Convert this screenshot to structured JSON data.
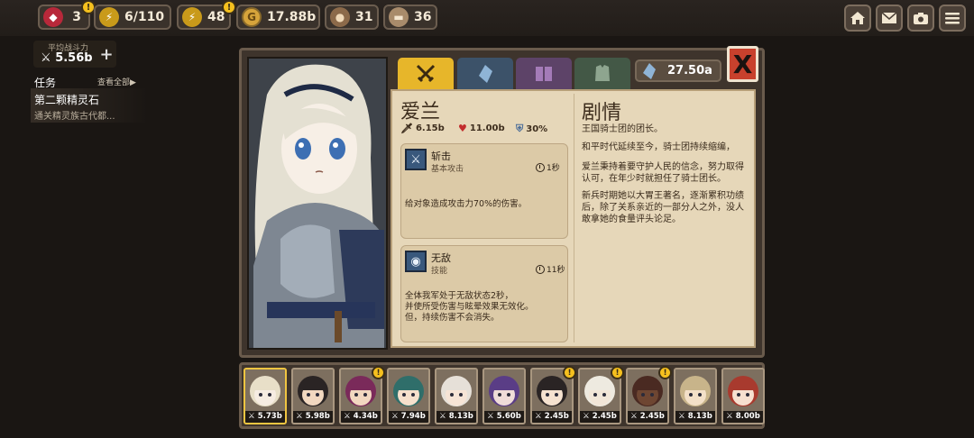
{
  "resources": {
    "gems": "3",
    "energy": "6/110",
    "energy_charge": "48",
    "gold": "17.88b",
    "ore": "31",
    "wood": "36"
  },
  "top_buttons": [
    "home-icon",
    "mail-icon",
    "camera-icon",
    "menu-icon"
  ],
  "left_panel": {
    "power_label": "平均战斗力",
    "power_value": "5.56b",
    "quest_header": "任务",
    "quest_view_all": "查看全部▶",
    "quest_name": "第二颗精灵石",
    "quest_desc": "通关精灵族古代都..."
  },
  "dialog": {
    "currency": "27.50a",
    "tabs": [
      "sword-icon",
      "crystal-icon",
      "book-icon",
      "armor-icon"
    ],
    "close": "X",
    "character": {
      "name": "爱兰",
      "attack": "6.15b",
      "hp": "11.00b",
      "defense": "30%"
    },
    "skills": [
      {
        "name": "斩击",
        "type": "基本攻击",
        "cooldown": "1秒",
        "desc": "给对象造成攻击力70%的伤害。"
      },
      {
        "name": "无敌",
        "type": "技能",
        "cooldown": "11秒",
        "desc": "全体我军处于无敌状态2秒，\n并使所受伤害与眩晕效果无效化。\n但，持续伤害不会消失。"
      }
    ],
    "story": {
      "title": "剧情",
      "paragraphs": [
        "王国骑士团的团长。",
        "和平时代延续至今，骑士团持续缩编，",
        "爱兰秉持着要守护人民的信念，努力取得认可，在年少时就担任了骑士团长。",
        "新兵时期她以大胃王著名，逐渐累积功绩后，除了关系亲近的一部分人之外，没人敢拿她的食量评头论足。"
      ]
    }
  },
  "roster": [
    {
      "power": "5.73b",
      "alert": false,
      "selected": true
    },
    {
      "power": "5.98b",
      "alert": false,
      "selected": false
    },
    {
      "power": "4.34b",
      "alert": true,
      "selected": false
    },
    {
      "power": "7.94b",
      "alert": false,
      "selected": false
    },
    {
      "power": "8.13b",
      "alert": false,
      "selected": false
    },
    {
      "power": "5.60b",
      "alert": false,
      "selected": false
    },
    {
      "power": "2.45b",
      "alert": true,
      "selected": false
    },
    {
      "power": "2.45b",
      "alert": true,
      "selected": false
    },
    {
      "power": "2.45b",
      "alert": true,
      "selected": false
    },
    {
      "power": "8.13b",
      "alert": false,
      "selected": false
    },
    {
      "power": "8.00b",
      "alert": false,
      "selected": false
    }
  ],
  "colors": {
    "accent_tab": "#e7b62a",
    "close_button": "#c8412d",
    "parchment": "#e6d7b9"
  }
}
